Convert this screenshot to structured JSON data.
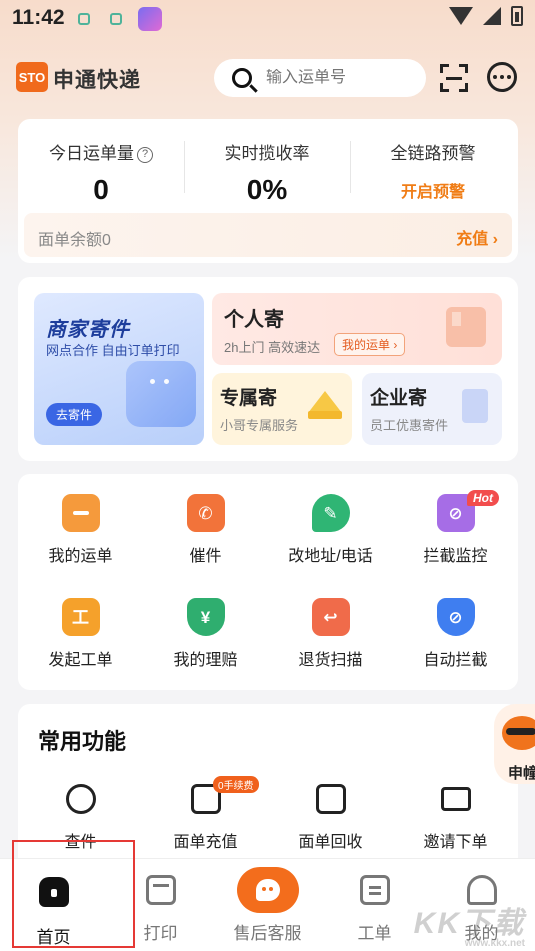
{
  "status_bar": {
    "time": "11:42"
  },
  "header": {
    "logo_text": "STO",
    "brand": "申通快递",
    "search_placeholder": "输入运单号"
  },
  "stats": {
    "items": [
      {
        "label": "今日运单量",
        "value": "0",
        "help": "?"
      },
      {
        "label": "实时揽收率",
        "value": "0%"
      },
      {
        "label": "全链路预警",
        "action": "开启预警"
      }
    ],
    "balance_label": "面单余额0",
    "recharge_label": "充值 ›"
  },
  "shipping": {
    "merchant": {
      "title": "商家寄件",
      "subtitle": "网点合作 自由订单打印",
      "button": "去寄件"
    },
    "personal": {
      "title": "个人寄",
      "subtitle": "2h上门 高效速达",
      "tag": "我的运单 ›"
    },
    "exclusive": {
      "title": "专属寄",
      "subtitle": "小哥专属服务"
    },
    "enterprise": {
      "title": "企业寄",
      "subtitle": "员工优惠寄件"
    }
  },
  "grid": {
    "items": [
      {
        "label": "我的运单",
        "color": "#f59a3c",
        "icon": "waybill-icon"
      },
      {
        "label": "催件",
        "color": "#f2733a",
        "icon": "phone-icon"
      },
      {
        "label": "改地址/电话",
        "color": "#2fb574",
        "icon": "edit-icon"
      },
      {
        "label": "拦截监控",
        "color": "#a66de6",
        "icon": "intercept-icon",
        "badge": "Hot"
      },
      {
        "label": "发起工单",
        "color": "#f5a12b",
        "icon": "ticket-icon"
      },
      {
        "label": "我的理赔",
        "color": "#2fae6f",
        "icon": "claim-icon"
      },
      {
        "label": "退货扫描",
        "color": "#f06b4a",
        "icon": "return-icon"
      },
      {
        "label": "自动拦截",
        "color": "#3f7ef0",
        "icon": "block-icon"
      }
    ]
  },
  "common": {
    "title": "常用功能",
    "items": [
      {
        "label": "查件",
        "icon": "search-icon"
      },
      {
        "label": "面单充值",
        "icon": "recharge-icon",
        "badge": "0手续费"
      },
      {
        "label": "面单回收",
        "icon": "recycle-icon"
      },
      {
        "label": "邀请下单",
        "icon": "mail-icon"
      }
    ],
    "floater_text": "申幢"
  },
  "tabbar": {
    "items": [
      {
        "label": "首页",
        "icon": "home-icon"
      },
      {
        "label": "打印",
        "icon": "print-icon"
      },
      {
        "label": "售后客服",
        "icon": "customer-service-icon"
      },
      {
        "label": "工单",
        "icon": "order-icon"
      },
      {
        "label": "我的",
        "icon": "profile-icon"
      }
    ]
  },
  "watermark": {
    "text": "KK下载",
    "url": "www.kkx.net"
  }
}
